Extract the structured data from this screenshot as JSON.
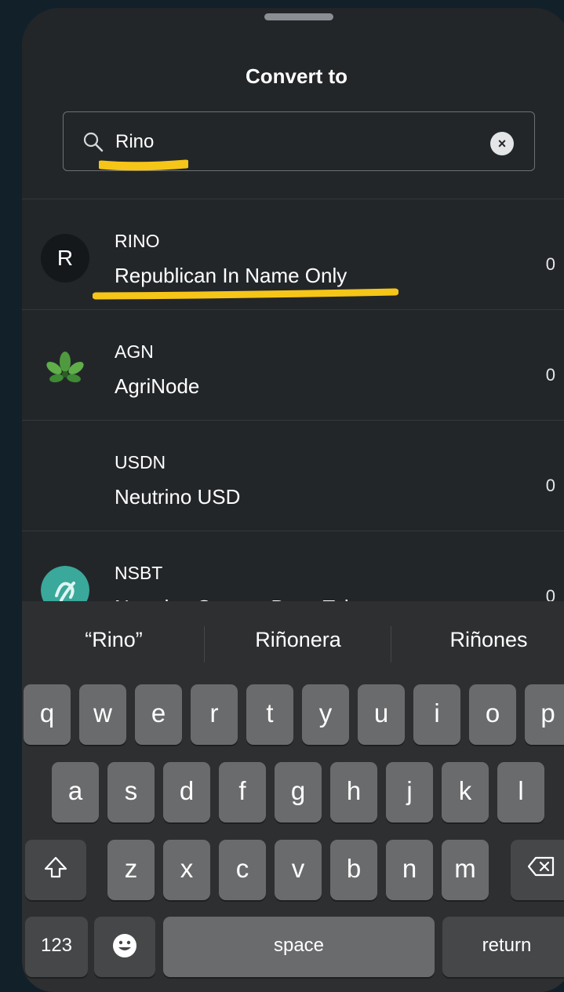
{
  "sheet": {
    "title": "Convert to"
  },
  "search": {
    "value": "Rino",
    "clear_symbol": "×"
  },
  "tokens": [
    {
      "symbol": "RINO",
      "name": "Republican In Name Only",
      "balance": "0",
      "icon": "letter-avatar",
      "icon_letter": "R"
    },
    {
      "symbol": "AGN",
      "name": "AgriNode",
      "balance": "0",
      "icon": "leaf-cluster-icon"
    },
    {
      "symbol": "USDN",
      "name": "Neutrino USD",
      "balance": "0",
      "icon": "none"
    },
    {
      "symbol": "NSBT",
      "name": "Neutrino System Base Token",
      "balance": "0",
      "icon": "nsbt-logo-icon"
    }
  ],
  "keyboard": {
    "suggestions": [
      "“Rino”",
      "Riñonera",
      "Riñones"
    ],
    "row1": [
      "q",
      "w",
      "e",
      "r",
      "t",
      "y",
      "u",
      "i",
      "o",
      "p"
    ],
    "row2": [
      "a",
      "s",
      "d",
      "f",
      "g",
      "h",
      "j",
      "k",
      "l"
    ],
    "row3": [
      "z",
      "x",
      "c",
      "v",
      "b",
      "n",
      "m"
    ],
    "numbers_label": "123",
    "space_label": "space",
    "return_label": "return"
  },
  "colors": {
    "background": "#12202a",
    "sheet": "#232629",
    "highlight": "#f5c518",
    "key": "#6a6b6d",
    "key_dark": "#454749"
  }
}
